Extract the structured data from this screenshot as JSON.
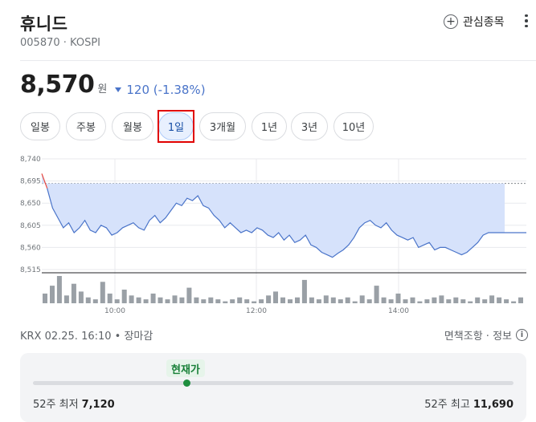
{
  "stock": {
    "name": "휴니드",
    "code_market": "005870 · KOSPI",
    "price": "8,570",
    "unit": "원",
    "change": "120 (-1.38%)"
  },
  "actions": {
    "watch_label": "관심종목",
    "plus_icon": "plus-circle-icon",
    "more_icon": "more-vert-icon"
  },
  "tabs": [
    {
      "label": "일봉",
      "active": false
    },
    {
      "label": "주봉",
      "active": false
    },
    {
      "label": "월봉",
      "active": false
    },
    {
      "label": "1일",
      "active": true
    },
    {
      "label": "3개월",
      "active": false
    },
    {
      "label": "1년",
      "active": false
    },
    {
      "label": "3년",
      "active": false
    },
    {
      "label": "10년",
      "active": false
    }
  ],
  "colors": {
    "down": "#4a74c9",
    "up": "#e8453c",
    "highlight": "#e00000",
    "range_dot": "#1e8e3e",
    "badge_text": "#188038",
    "badge_bg": "#e6f4ea"
  },
  "chart_data": {
    "type": "line",
    "y_ticks": [
      "8,740",
      "8,695",
      "8,650",
      "8,605",
      "8,560",
      "8,515"
    ],
    "x_ticks": [
      "10:00",
      "12:00",
      "14:00"
    ],
    "ylim": [
      8515,
      8740
    ],
    "previous_close": 8690,
    "grid": true,
    "series": [
      {
        "values": [
          8710,
          8680,
          8640,
          8620,
          8600,
          8610,
          8590,
          8600,
          8615,
          8595,
          8590,
          8605,
          8600,
          8585,
          8590,
          8600,
          8605,
          8610,
          8600,
          8595,
          8615,
          8625,
          8610,
          8620,
          8635,
          8650,
          8645,
          8660,
          8655,
          8665,
          8645,
          8640,
          8625,
          8615,
          8600,
          8610,
          8600,
          8590,
          8595,
          8590,
          8600,
          8595,
          8585,
          8580,
          8590,
          8575,
          8585,
          8570,
          8575,
          8585,
          8565,
          8560,
          8550,
          8545,
          8540,
          8548,
          8555,
          8565,
          8580,
          8600,
          8610,
          8615,
          8605,
          8600,
          8610,
          8595,
          8585,
          8580,
          8575,
          8580,
          8560,
          8565,
          8570,
          8555,
          8560,
          8560,
          8555,
          8550,
          8545,
          8550,
          8560,
          8570,
          8585,
          8590,
          8590,
          8590,
          8590
        ]
      }
    ],
    "volume": [
      5,
      9,
      14,
      4,
      10,
      6,
      3,
      2,
      11,
      5,
      2,
      7,
      4,
      3,
      2,
      5,
      3,
      2,
      4,
      3,
      8,
      3,
      2,
      3,
      2,
      1,
      2,
      3,
      2,
      1,
      2,
      4,
      6,
      3,
      2,
      3,
      12,
      3,
      2,
      4,
      3,
      2,
      3,
      1,
      4,
      2,
      9,
      3,
      2,
      5,
      2,
      3,
      1,
      2,
      3,
      4,
      2,
      3,
      2,
      1,
      3,
      2,
      4,
      3,
      2,
      1,
      3
    ]
  },
  "footer": {
    "source_time": "KRX 02.25. 16:10 • 장마감",
    "disclaimer": "면책조항 · 정보",
    "info_icon": "info-icon"
  },
  "range52": {
    "badge": "현재가",
    "low_label": "52주 최저",
    "low_value": "7,120",
    "high_label": "52주 최고",
    "high_value": "11,690"
  }
}
